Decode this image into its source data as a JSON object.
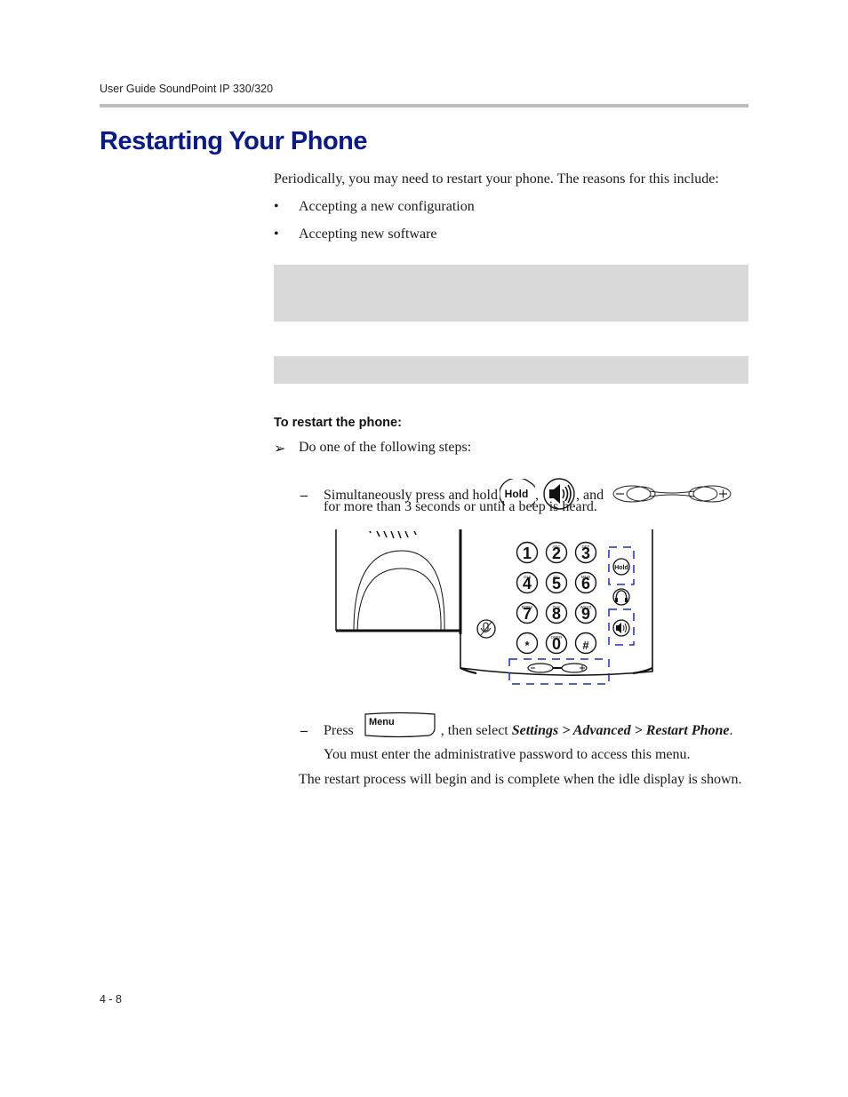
{
  "header": {
    "running_title": "User Guide SoundPoint IP 330/320"
  },
  "page": {
    "title": "Restarting Your Phone",
    "intro": "Periodically, you may need to restart your phone. The reasons for this include:",
    "reasons": [
      {
        "bullet": "•",
        "text": "Accepting a new configuration"
      },
      {
        "bullet": "•",
        "text": "Accepting new software"
      }
    ],
    "procedure": {
      "heading": "To restart the phone:",
      "step_marker": "➢",
      "step": "Do one of the following steps:",
      "option1": {
        "dash": "–",
        "text_before": "Simultaneously press and hold",
        "sep1": ",",
        "text_and": ", and",
        "line2": "for more than 3 seconds or until a beep is heard.",
        "hold_key_label": "Hold",
        "icons": [
          "hold-key-icon",
          "speaker-key-icon",
          "volume-key-icon"
        ]
      },
      "diagram": {
        "keypad": [
          {
            "digit": "1",
            "letters": ""
          },
          {
            "digit": "2",
            "letters": "ABC"
          },
          {
            "digit": "3",
            "letters": "DEF"
          },
          {
            "digit": "4",
            "letters": "GHI"
          },
          {
            "digit": "5",
            "letters": "JKL"
          },
          {
            "digit": "6",
            "letters": "MNO"
          },
          {
            "digit": "7",
            "letters": "PQRS"
          },
          {
            "digit": "8",
            "letters": "TUV"
          },
          {
            "digit": "9",
            "letters": "WXYZ"
          },
          {
            "digit": "*",
            "letters": ""
          },
          {
            "digit": "0",
            "letters": "OPER"
          },
          {
            "digit": "#",
            "letters": ""
          }
        ],
        "hold_label": "Hold",
        "highlight_color": "#1a2fc4"
      },
      "option2": {
        "dash": "–",
        "press": "Press",
        "menu_key_label": "Menu",
        "then_select": ", then select",
        "path": "Settings > Advanced > Restart Phone",
        "end": "."
      },
      "note": "You must enter the administrative password to access this menu.",
      "result": "The restart process will begin and is complete when the idle display is shown."
    }
  },
  "footer": {
    "page_number": "4 - 8"
  },
  "colors": {
    "title": "#0b1a8a",
    "rule": "#bdbdbd",
    "shaded_box": "#d9d9d9"
  }
}
